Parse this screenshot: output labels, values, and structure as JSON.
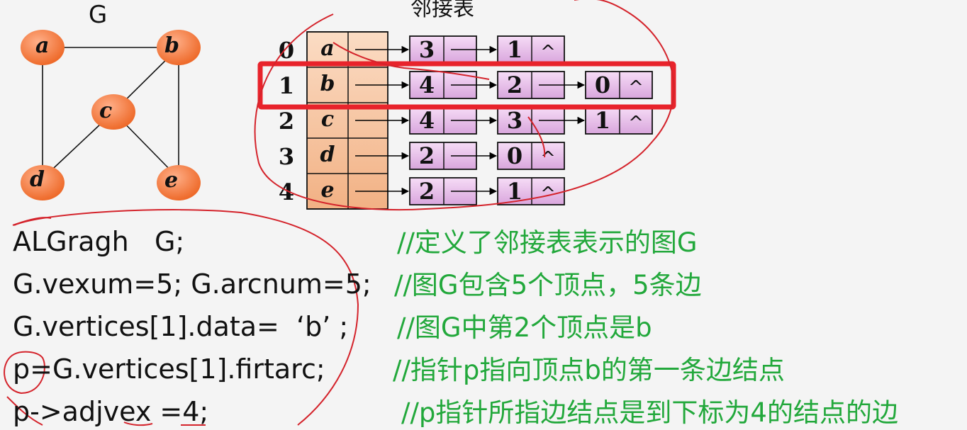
{
  "graph": {
    "title": "G",
    "vertices": [
      "a",
      "b",
      "c",
      "d",
      "e"
    ],
    "edges": [
      [
        "a",
        "b"
      ],
      [
        "a",
        "d"
      ],
      [
        "b",
        "c"
      ],
      [
        "b",
        "e"
      ],
      [
        "c",
        "d"
      ],
      [
        "c",
        "e"
      ]
    ]
  },
  "adj_list": {
    "title": "邻接表",
    "rows": [
      {
        "index": "0",
        "vertex": "a",
        "adj": [
          "3",
          "1"
        ]
      },
      {
        "index": "1",
        "vertex": "b",
        "adj": [
          "4",
          "2",
          "0"
        ]
      },
      {
        "index": "2",
        "vertex": "c",
        "adj": [
          "4",
          "3",
          "1"
        ]
      },
      {
        "index": "3",
        "vertex": "d",
        "adj": [
          "2",
          "0"
        ]
      },
      {
        "index": "4",
        "vertex": "e",
        "adj": [
          "2",
          "1"
        ]
      }
    ],
    "null_symbol": "^",
    "highlighted_row": 1
  },
  "code": [
    {
      "line": "ALGragh   G;",
      "comment": "//定义了邻接表表示的图G"
    },
    {
      "line": "G.vexum=5; G.arcnum=5;",
      "comment": "//图G包含5个顶点，5条边"
    },
    {
      "line": "G.vertices[1].data=  ‘b’ ;",
      "comment": "//图G中第2个顶点是b"
    },
    {
      "line": "p=G.vertices[1].firtarc;",
      "comment": "//指针p指向顶点b的第一条边结点"
    },
    {
      "line": "p->adjvex =4;",
      "comment": "//p指针所指边结点是到下标为4的结点的边"
    }
  ],
  "colors": {
    "vertex_fill": "#f07a3c",
    "head_fill": "#f7c9a8",
    "edge_node_fill": "#ecc8ee",
    "highlight": "#e8232b",
    "annotation": "#d4232b",
    "comment": "#22a83b"
  }
}
